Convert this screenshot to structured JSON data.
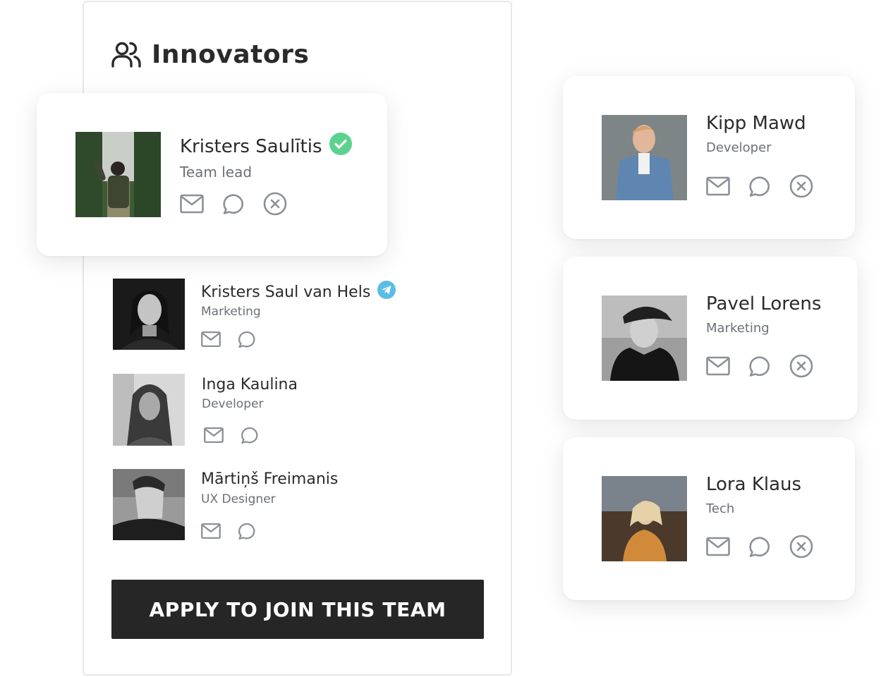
{
  "team": {
    "title": "Innovators",
    "title_icon": "users-icon",
    "apply_label": "APPLY TO JOIN THIS TEAM"
  },
  "lead": {
    "name": "Kristers Saulītis",
    "role": "Team lead",
    "badge": "verified-check-icon"
  },
  "members": [
    {
      "name": "Kristers Saul van Hels",
      "role": "Marketing",
      "badge": "telegram-icon"
    },
    {
      "name": "Inga Kaulina",
      "role": "Developer"
    },
    {
      "name": "Mārtiņš Freimanis",
      "role": "UX Designer"
    }
  ],
  "invited": [
    {
      "name": "Kipp Mawd",
      "role": "Developer"
    },
    {
      "name": "Pavel Lorens",
      "role": "Marketing"
    },
    {
      "name": "Lora Klaus",
      "role": "Tech"
    }
  ],
  "colors": {
    "verified": "#5cd28f",
    "telegram": "#59bde6",
    "button_bg": "#262626",
    "icon": "#8c9097"
  }
}
